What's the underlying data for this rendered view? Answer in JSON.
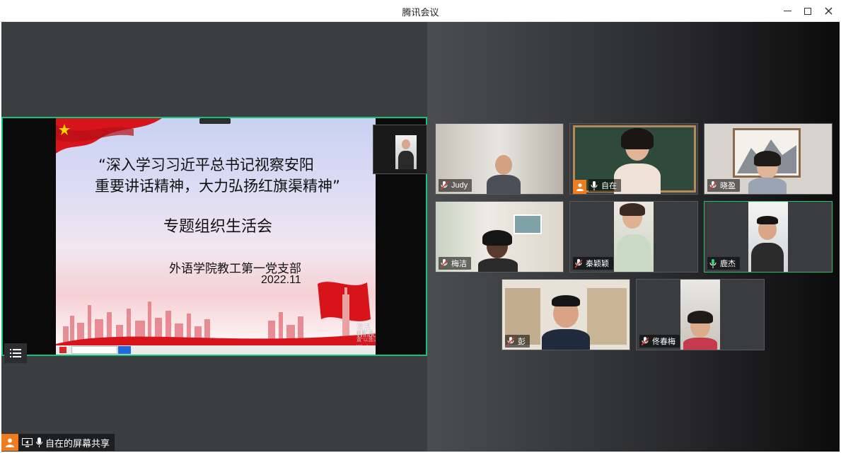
{
  "window": {
    "title": "腾讯会议"
  },
  "share": {
    "slide": {
      "line1": "“深入学习习近平总书记视察安阳",
      "line2": "重要讲话精神，大力弘扬红旗渠精神”",
      "line3": "专题组织生活会",
      "line4": "外语学院教工第一党支部",
      "line5": "2022.11"
    },
    "watermark": "激活 Windows",
    "watermark_sub": "转到\"设置\"以激活 Windows。",
    "status_label": "自在的屏幕共享"
  },
  "participants": [
    {
      "name": "Judy",
      "mic": "muted"
    },
    {
      "name": "自在",
      "mic": "muted",
      "host": true
    },
    {
      "name": "晓盈",
      "mic": "muted"
    },
    {
      "name": "梅洁",
      "mic": "muted"
    },
    {
      "name": "秦颖颖",
      "mic": "muted"
    },
    {
      "name": "鹿杰",
      "mic": "active"
    },
    {
      "name": "彭",
      "mic": "muted"
    },
    {
      "name": "佟春梅",
      "mic": "muted"
    }
  ],
  "colors": {
    "accent_green": "#13c27b",
    "host_orange": "#f07c1e",
    "mute_red": "#e03b3b"
  },
  "icons": [
    "minimize-icon",
    "maximize-icon",
    "close-icon",
    "mic-muted-icon",
    "mic-icon",
    "screen-share-icon",
    "user-icon",
    "list-icon"
  ]
}
